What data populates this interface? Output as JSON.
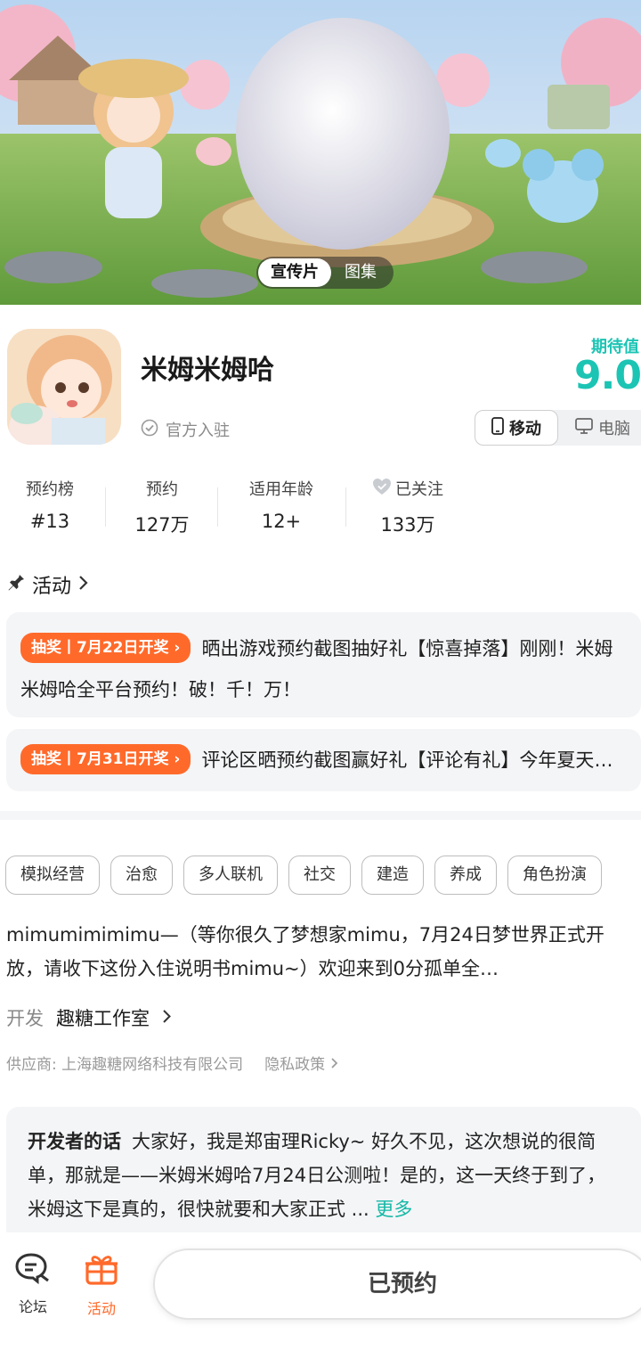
{
  "banner": {
    "tabs": [
      {
        "label": "宣传片",
        "active": true
      },
      {
        "label": "图集",
        "active": false
      }
    ]
  },
  "game": {
    "title": "米姆米姆哈",
    "official_label": "官方入驻",
    "expect_label": "期待值",
    "expect_score": "9.0",
    "platforms": [
      {
        "label": "移动",
        "icon": "phone-icon",
        "active": true
      },
      {
        "label": "电脑",
        "icon": "monitor-icon",
        "active": false
      }
    ]
  },
  "stats": [
    {
      "label": "预约榜",
      "value": "#13"
    },
    {
      "label": "预约",
      "value": "127万"
    },
    {
      "label": "适用年龄",
      "value": "12+"
    },
    {
      "label": "已关注",
      "value": "133万"
    }
  ],
  "activity": {
    "title": "活动",
    "items": [
      {
        "badge": "抽奖丨7月22日开奖",
        "text": "晒出游戏预约截图抽好礼【惊喜掉落】刚刚！米姆米姆哈全平台预约！破！千！万！"
      },
      {
        "badge": "抽奖丨7月31日开奖",
        "text": "评论区晒预约截图赢好礼【评论有礼】今年夏天你最想和谁一起玩米姆米姆哈"
      }
    ]
  },
  "tags": [
    "模拟经营",
    "治愈",
    "多人联机",
    "社交",
    "建造",
    "养成",
    "角色扮演"
  ],
  "description": "mimumimimimu—（等你很久了梦想家mimu，7月24日梦世界正式开放，请收下这份入住说明书mimu~）欢迎来到0分孤单全…",
  "developer": {
    "key": "开发",
    "value": "趣糖工作室"
  },
  "supplier": {
    "text": "供应商: 上海趣糖网络科技有限公司",
    "privacy": "隐私政策"
  },
  "dev_words": {
    "title": "开发者的话",
    "text": "大家好，我是郑宙理Ricky~ 好久不见，这次想说的很简单，那就是——米姆米姆哈7月24日公测啦！是的，这一天终于到了，米姆这下是真的，很快就要和大家正式 ...",
    "more": "更多"
  },
  "bottom_nav": [
    {
      "label": "论坛",
      "icon": "forum-icon",
      "active": false
    },
    {
      "label": "活动",
      "icon": "gift-icon",
      "active": true
    }
  ],
  "reserve_button": "已预约",
  "colors": {
    "accent": "#1cc4b4",
    "badge": "#ff6a2b",
    "active_nav": "#ff6a2b"
  }
}
